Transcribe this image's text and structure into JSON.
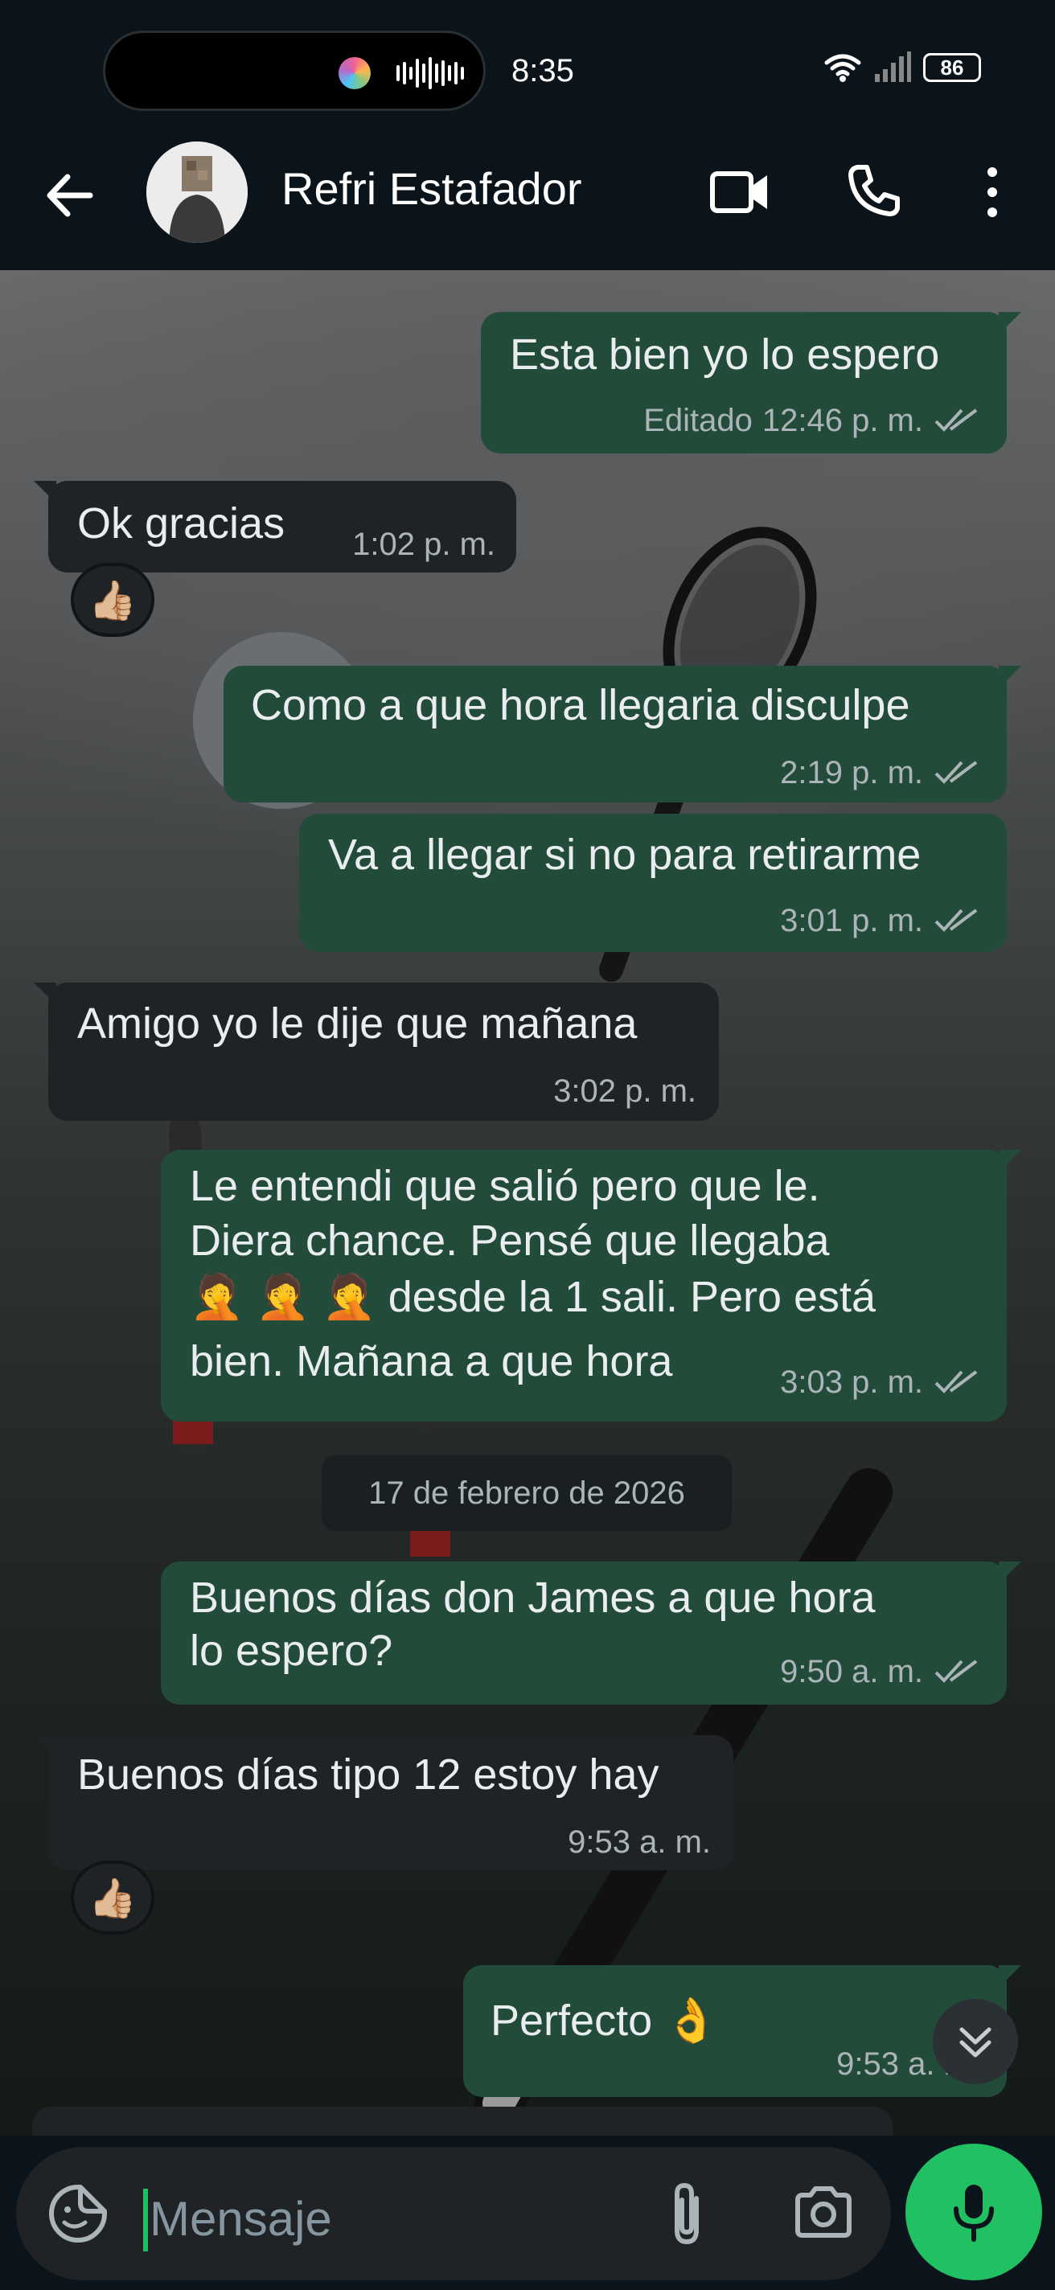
{
  "status_bar": {
    "time": "8:35",
    "battery": "86",
    "icons": [
      "recording-indicator-icon",
      "audio-wave-icon",
      "wifi-icon",
      "signal-icon",
      "battery-icon"
    ]
  },
  "header": {
    "contact_name": "Refri Estafador",
    "icons": [
      "back-arrow-icon",
      "avatar",
      "video-call-icon",
      "phone-icon",
      "more-vert-icon"
    ]
  },
  "messages": [
    {
      "id": "m1",
      "direction": "out",
      "text": "Esta bien yo lo espero",
      "edited_label": "Editado",
      "time": "12:46 p. m.",
      "status": "read"
    },
    {
      "id": "m2",
      "direction": "in",
      "text": "Ok gracias",
      "time": "1:02 p. m.",
      "reaction": "👍🏼"
    },
    {
      "id": "m3",
      "direction": "out",
      "text": "Como a que hora llegaria disculpe",
      "time": "2:19 p. m.",
      "status": "read"
    },
    {
      "id": "m4",
      "direction": "out",
      "text": "Va a llegar si no para retirarme",
      "time": "3:01 p. m.",
      "status": "read"
    },
    {
      "id": "m5",
      "direction": "in",
      "text": "Amigo yo le dije que mañana",
      "time": "3:02 p. m."
    },
    {
      "id": "m6",
      "direction": "out",
      "lines": [
        "Le entendi que salió pero que le.",
        "Diera chance. Pensé que llegaba",
        "🤦 🤦 🤦 desde la 1 sali. Pero está",
        "bien. Mañana a que hora"
      ],
      "time": "3:03 p. m.",
      "status": "read"
    },
    {
      "id": "m7",
      "direction": "out",
      "lines": [
        "Buenos días don James a que hora",
        "lo espero?"
      ],
      "time": "9:50 a. m.",
      "status": "read"
    },
    {
      "id": "m8",
      "direction": "in",
      "text": "Buenos días tipo 12 estoy hay",
      "time": "9:53 a. m.",
      "reaction": "👍🏼"
    },
    {
      "id": "m9",
      "direction": "out",
      "text": "Perfecto 👌",
      "time": "9:53 a. m.",
      "status": "read"
    }
  ],
  "date_divider": "17 de febrero de 2026",
  "composer": {
    "placeholder": "Mensaje",
    "icons": [
      "sticker-icon",
      "attach-icon",
      "camera-icon",
      "mic-icon"
    ]
  },
  "colors": {
    "outgoing_bubble": "#234b3a",
    "incoming_bubble": "#1f2326",
    "accent": "#21c063",
    "read_ticks": "#aab4b9"
  }
}
